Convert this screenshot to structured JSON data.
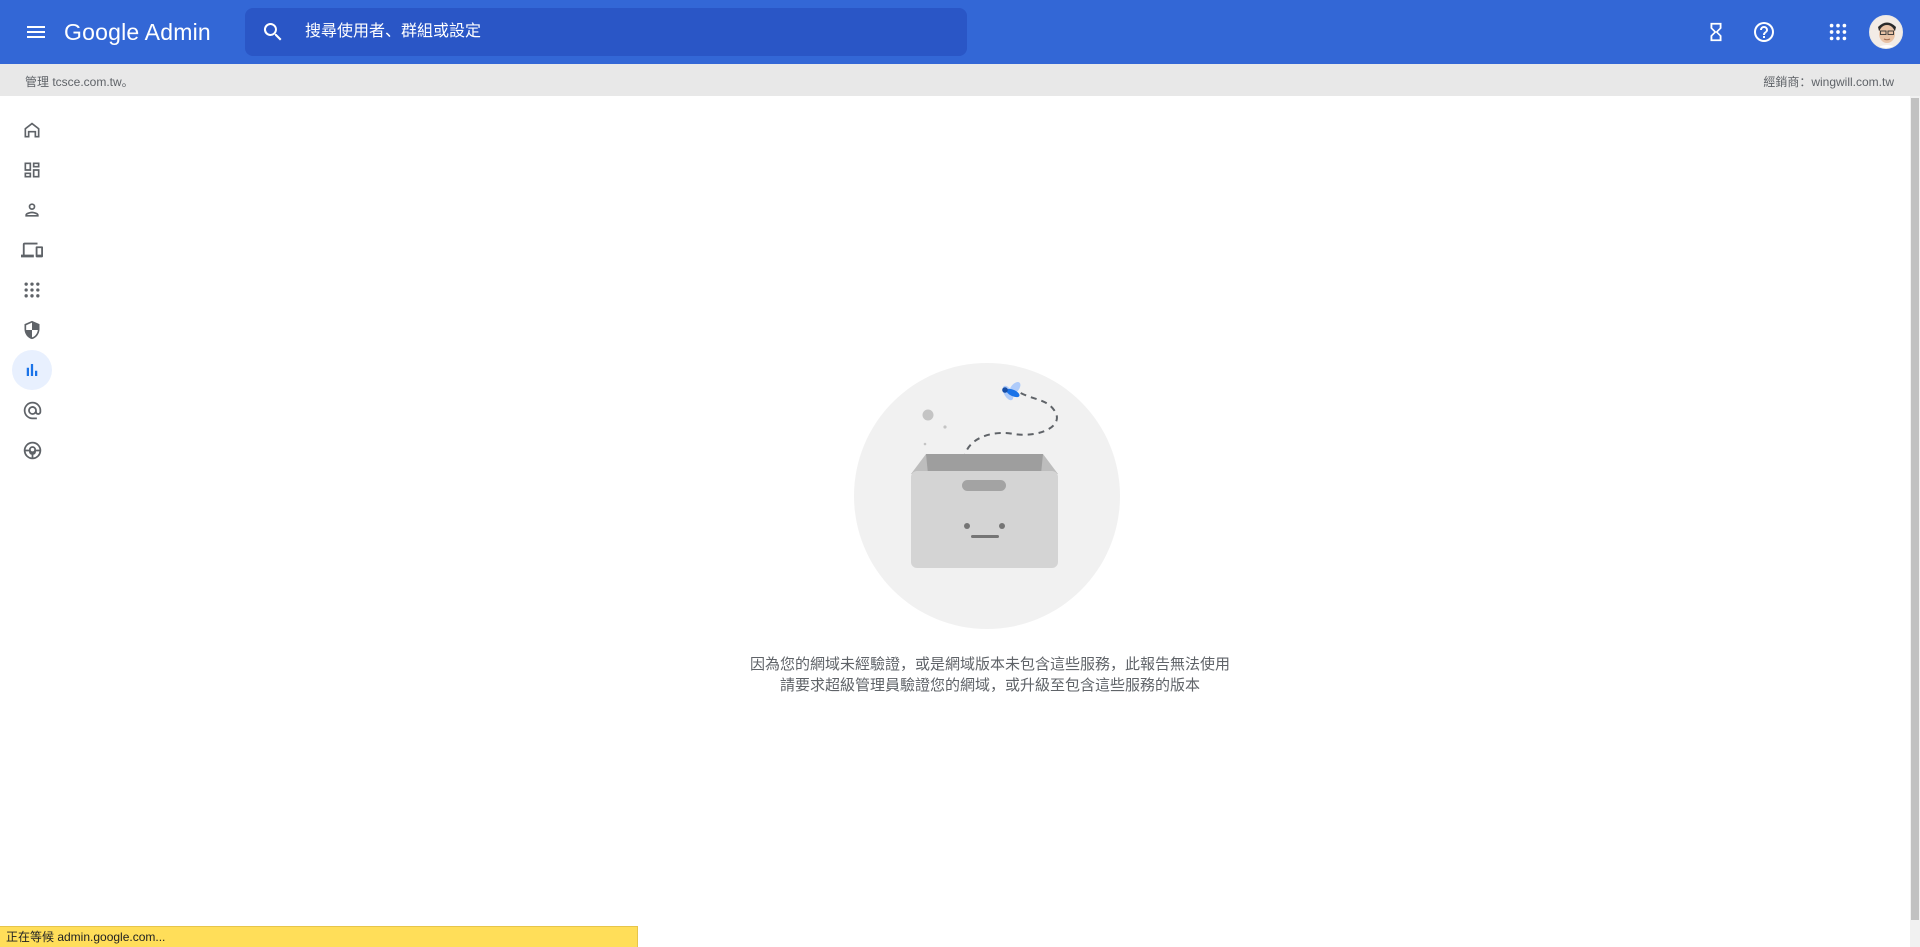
{
  "header": {
    "brand": "Google Admin",
    "search": {
      "placeholder": "搜尋使用者、群組或設定"
    },
    "icons": [
      "menu-icon",
      "search-icon",
      "hourglass-icon",
      "help-icon",
      "apps-grid-icon"
    ]
  },
  "subbar": {
    "managing": "管理 tcsce.com.tw。",
    "reseller": "經銷商：wingwill.com.tw"
  },
  "nav": {
    "items": [
      {
        "icon": "home-icon"
      },
      {
        "icon": "dashboard-icon"
      },
      {
        "icon": "person-icon"
      },
      {
        "icon": "devices-icon"
      },
      {
        "icon": "apps-icon"
      },
      {
        "icon": "security-shield-icon"
      },
      {
        "icon": "reports-chart-icon",
        "active": true
      },
      {
        "icon": "email-at-icon"
      },
      {
        "icon": "support-icon"
      }
    ]
  },
  "main": {
    "empty_state": {
      "line1": "因為您的網域未經驗證，或是網域版本未包含這些服務，此報告無法使用",
      "line2": "請要求超級管理員驗證您的網域，或升級至包含這些服務的版本"
    }
  },
  "status_bar": {
    "text": "正在等候 admin.google.com..."
  },
  "colors": {
    "appbar": "#3367d6",
    "search_bg": "#2a56c6",
    "active_nav": "#e8f0fe",
    "accent": "#1a73e8",
    "status_bg": "#ffde59"
  }
}
